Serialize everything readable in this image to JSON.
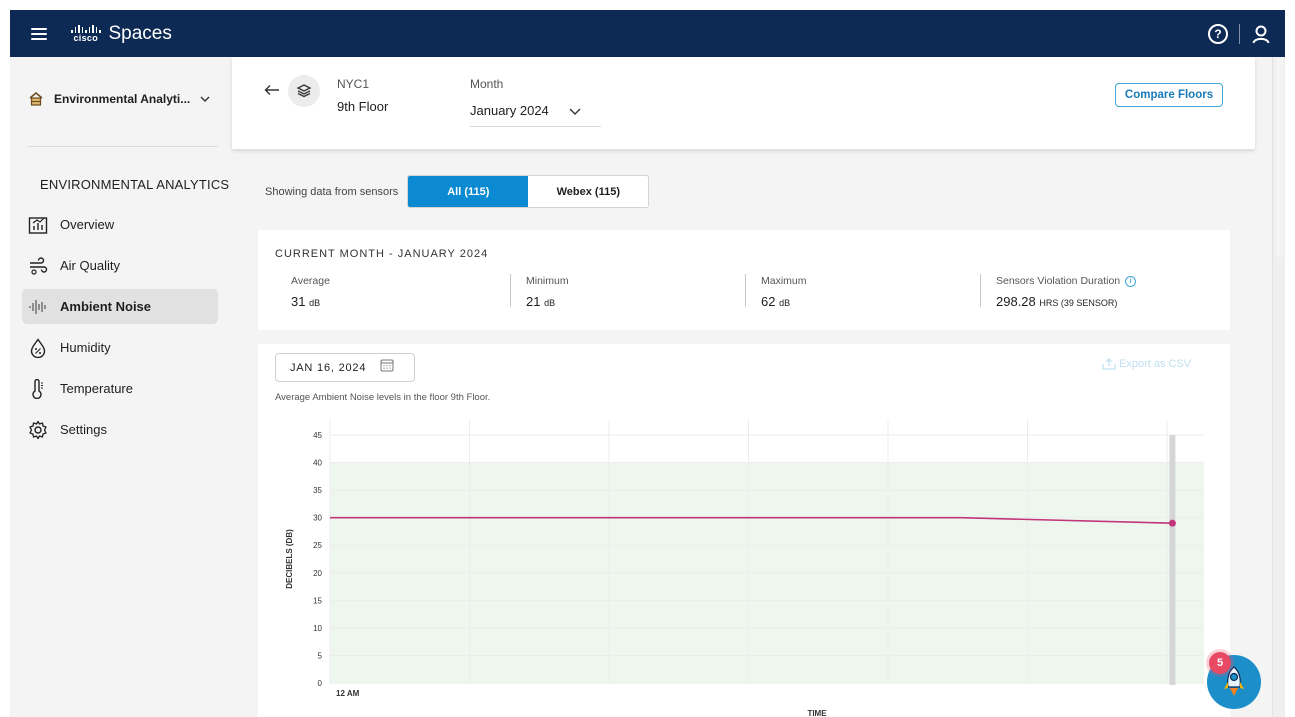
{
  "topbar": {
    "logo_text": "cisco",
    "app_name": "Spaces",
    "help_icon": "help-circle-icon",
    "user_icon": "user-icon"
  },
  "sidebar": {
    "app_selector": "Environmental Analyti...",
    "section_title": "ENVIRONMENTAL ANALYTICS",
    "items": [
      {
        "label": "Overview",
        "icon": "overview-chart-icon",
        "active": false
      },
      {
        "label": "Air Quality",
        "icon": "air-quality-icon",
        "active": false
      },
      {
        "label": "Ambient Noise",
        "icon": "noise-wave-icon",
        "active": true
      },
      {
        "label": "Humidity",
        "icon": "humidity-drop-icon",
        "active": false
      },
      {
        "label": "Temperature",
        "icon": "thermometer-icon",
        "active": false
      },
      {
        "label": "Settings",
        "icon": "gear-icon",
        "active": false
      }
    ]
  },
  "header": {
    "site": "NYC1",
    "floor": "9th Floor",
    "month_label": "Month",
    "month_value": "January 2024",
    "compare_button": "Compare Floors"
  },
  "sensors": {
    "label": "Showing data from sensors",
    "options": [
      "All (115)",
      "Webex (115)"
    ],
    "selected": "All (115)"
  },
  "stats": {
    "title": "CURRENT MONTH - JANUARY 2024",
    "average_label": "Average",
    "average_value": "31",
    "average_unit": "dB",
    "minimum_label": "Minimum",
    "minimum_value": "21",
    "minimum_unit": "dB",
    "maximum_label": "Maximum",
    "maximum_value": "62",
    "maximum_unit": "dB",
    "violation_label": "Sensors Violation Duration",
    "violation_value": "298.28",
    "violation_unit": "HRS (39 SENSOR)"
  },
  "chart_section": {
    "date": "JAN 16, 2024",
    "export_label": "Export as CSV",
    "description": "Average Ambient Noise levels in the floor 9th Floor."
  },
  "fab": {
    "badge": "5"
  },
  "chart_data": {
    "type": "line",
    "title": "",
    "xlabel": "TIME",
    "ylabel": "DECIBELS (DB)",
    "ylim": [
      0,
      45
    ],
    "yticks": [
      0,
      5,
      10,
      15,
      20,
      25,
      30,
      35,
      40,
      45
    ],
    "x_tick_labels": [
      "12 AM"
    ],
    "threshold_band": [
      0,
      40
    ],
    "grid": true,
    "series": [
      {
        "color": "#c2357a",
        "points": [
          {
            "x": 0,
            "y": 30
          },
          {
            "x": 2,
            "y": 30
          },
          {
            "x": 4,
            "y": 30
          },
          {
            "x": 6,
            "y": 30
          },
          {
            "x": 8,
            "y": 29
          }
        ]
      }
    ]
  }
}
